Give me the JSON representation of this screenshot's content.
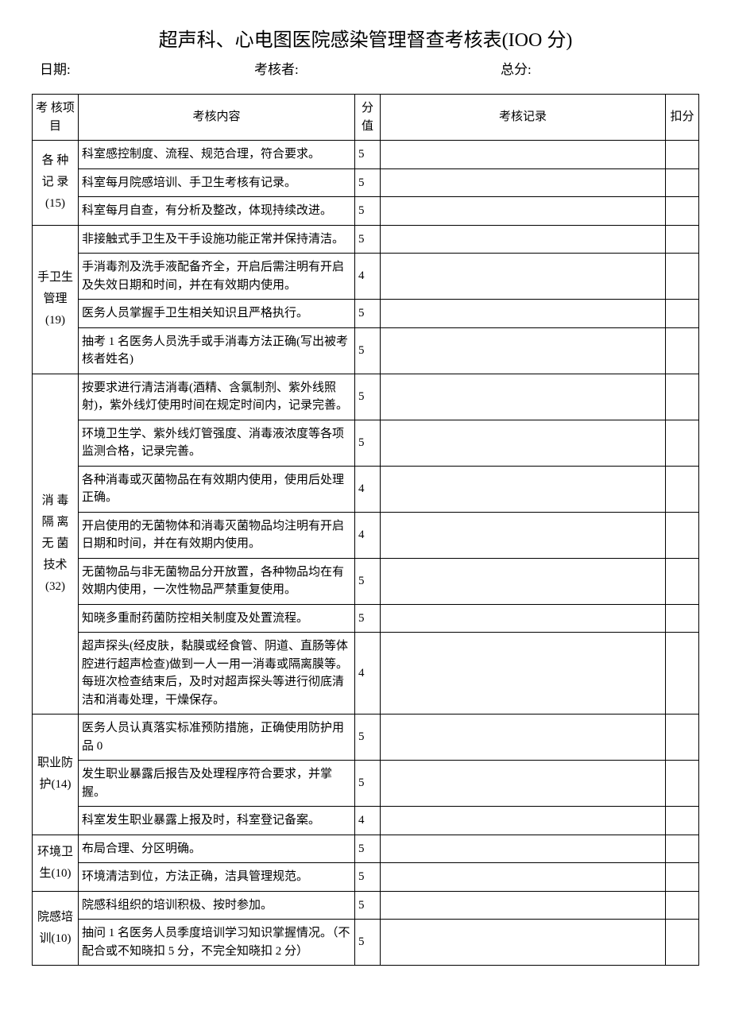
{
  "title": "超声科、心电图医院感染管理督查考核表(IOO 分)",
  "meta": {
    "date_label": "日期:",
    "assessor_label": "考核者:",
    "total_label": "总分:"
  },
  "headers": {
    "category": "考 核项目",
    "content": "考核内容",
    "score": "分值",
    "record": "考核记录",
    "deduct": "扣分"
  },
  "sections": [
    {
      "category": "各 种记 录(15)",
      "rows": [
        {
          "content": "科室感控制度、流程、规范合理，符合要求。",
          "score": "5"
        },
        {
          "content": "科室每月院感培训、手卫生考核有记录。",
          "score": "5"
        },
        {
          "content": "科室每月自查，有分析及整改，体现持续改进。",
          "score": "5"
        }
      ]
    },
    {
      "category": "手卫生管理(19)",
      "rows": [
        {
          "content": "非接触式手卫生及干手设施功能正常并保持清洁。",
          "score": "5"
        },
        {
          "content": "手消毒剂及洗手液配备齐全，开启后需注明有开启及失效日期和时间，并在有效期内使用。",
          "score": "4"
        },
        {
          "content": "医务人员掌握手卫生相关知识且严格执行。",
          "score": "5"
        },
        {
          "content": "抽考 1 名医务人员洗手或手消毒方法正确(写出被考核者姓名)",
          "score": "5"
        }
      ]
    },
    {
      "category": "消 毒隔 离无 菌技术 (32)",
      "rows": [
        {
          "content": "按要求进行清洁消毒(酒精、含氯制剂、紫外线照射)，紫外线灯使用时间在规定时间内，记录完善。",
          "score": "5"
        },
        {
          "content": "环境卫生学、紫外线灯管强度、消毒液浓度等各项监测合格，记录完善。",
          "score": "5"
        },
        {
          "content": "各种消毒或灭菌物品在有效期内使用，使用后处理正确。",
          "score": "4"
        },
        {
          "content": "开启使用的无菌物体和消毒灭菌物品均注明有开启日期和时间，并在有效期内使用。",
          "score": "4"
        },
        {
          "content": "无菌物品与非无菌物品分开放置，各种物品均在有效期内使用，一次性物品严禁重复使用。",
          "score": "5"
        },
        {
          "content": "知晓多重耐药菌防控相关制度及处置流程。",
          "score": "5"
        },
        {
          "content": "超声探头(经皮肤，黏膜或经食管、阴道、直肠等体腔进行超声检查)做到一人一用一消毒或隔离膜等。每班次检查结束后，及时对超声探头等进行彻底清洁和消毒处理，干燥保存。",
          "score": "4"
        }
      ]
    },
    {
      "category": "职业防护(14)",
      "rows": [
        {
          "content": "医务人员认真落实标准预防措施，正确使用防护用品 0",
          "score": "5"
        },
        {
          "content": "发生职业暴露后报告及处理程序符合要求，并掌握。",
          "score": "5"
        },
        {
          "content": "科室发生职业暴露上报及时，科室登记备案。",
          "score": "4"
        }
      ]
    },
    {
      "category": "环境卫生(10)",
      "rows": [
        {
          "content": "布局合理、分区明确。",
          "score": "5"
        },
        {
          "content": "环境清洁到位，方法正确，洁具管理规范。",
          "score": "5"
        }
      ]
    },
    {
      "category": "院感培训(10)",
      "rows": [
        {
          "content": "院感科组织的培训积极、按时参加。",
          "score": "5"
        },
        {
          "content": "抽问 1 名医务人员季度培训学习知识掌握情况。（不配合或不知晓扣 5 分，不完全知晓扣 2 分）",
          "score": "5"
        }
      ]
    }
  ]
}
